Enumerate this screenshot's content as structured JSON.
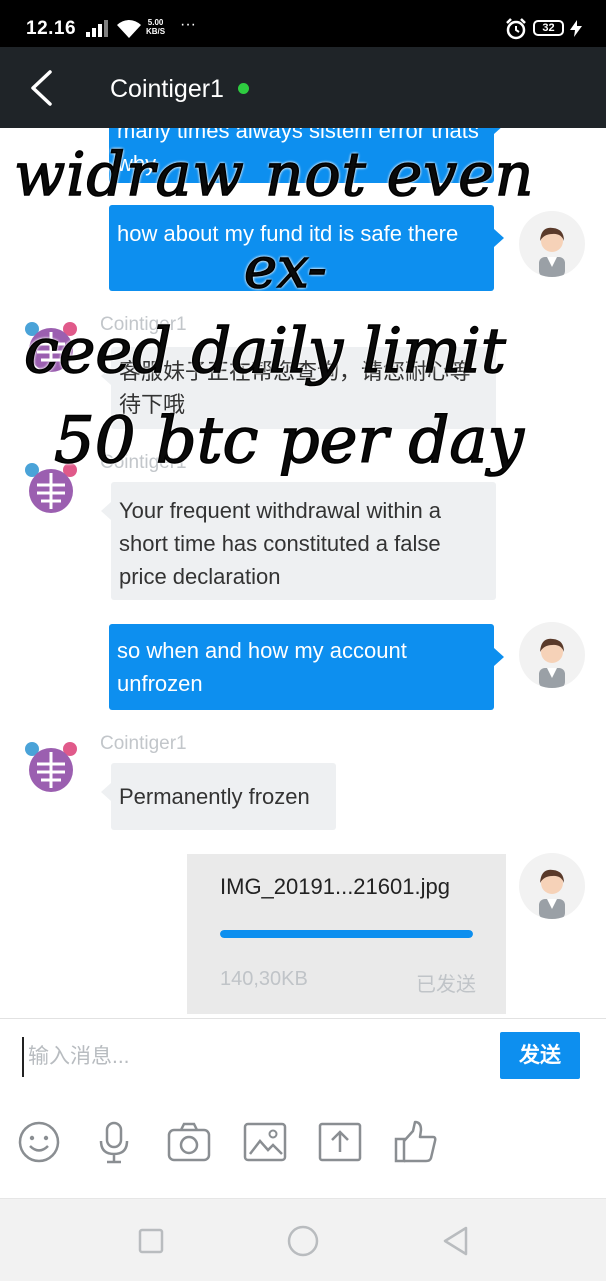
{
  "status_bar": {
    "time": "12.16",
    "speed_value": "5.00",
    "speed_unit": "KB/S",
    "battery": "32"
  },
  "header": {
    "title": "Cointiger1",
    "online_color": "#2ecc40"
  },
  "messages": [
    {
      "side": "out",
      "text": "many times always sistem error thats why"
    },
    {
      "side": "out",
      "text": "how about my fund itd is safe there"
    },
    {
      "side": "in",
      "sender": "Cointiger1",
      "text": "客服妹子正在帮您查询，请您耐心等待下哦"
    },
    {
      "side": "in",
      "sender": "Cointiger1",
      "text": "Your frequent withdrawal within a short time has constituted a false price declaration"
    },
    {
      "side": "out",
      "text": "so when and how my account unfrozen"
    },
    {
      "side": "in",
      "sender": "Cointiger1",
      "text": "Permanently frozen"
    }
  ],
  "file_message": {
    "filename": "IMG_20191...21601.jpg",
    "size": "140,30KB",
    "status": "已发送",
    "progress": 1.0
  },
  "overlay_text": {
    "line1": "widraw not even",
    "line2": "ex-",
    "line3": "ceed daily limit",
    "line4": "50 btc per day"
  },
  "composer": {
    "placeholder": "输入消息...",
    "send_label": "发送"
  },
  "toolbar_icons": [
    "emoji-icon",
    "microphone-icon",
    "camera-icon",
    "image-icon",
    "upload-icon",
    "thumbs-up-icon"
  ],
  "colors": {
    "accent": "#0d8fef",
    "header_bg": "#1f2428",
    "incoming_bubble": "#eef0f2"
  }
}
